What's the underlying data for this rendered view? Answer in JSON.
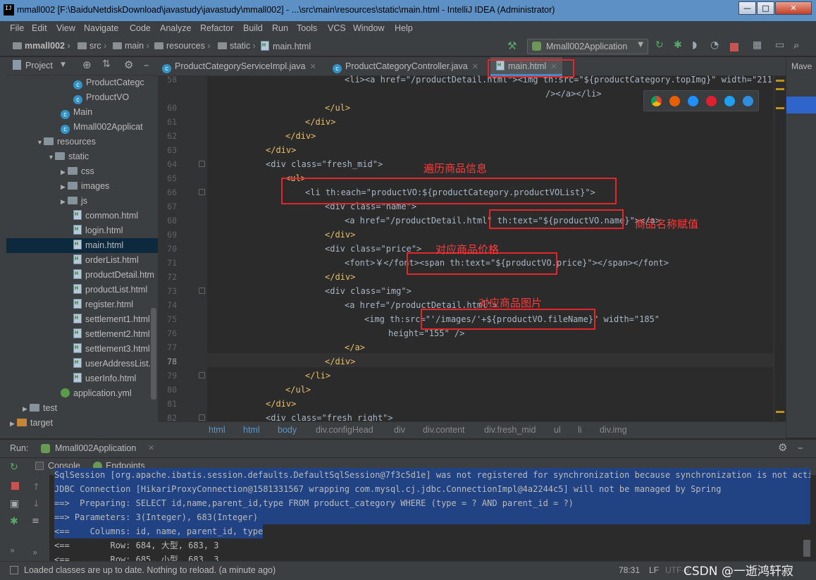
{
  "window": {
    "title": "mmall002 [F:\\BaiduNetdiskDownload\\javastudy\\javastudy\\mmall002] - ...\\src\\main\\resources\\static\\main.html - IntelliJ IDEA (Administrator)",
    "icon_text": "IJ",
    "min": "—",
    "max": "□",
    "close": "✕"
  },
  "menu": [
    "File",
    "Edit",
    "View",
    "Navigate",
    "Code",
    "Analyze",
    "Refactor",
    "Build",
    "Run",
    "Tools",
    "VCS",
    "Window",
    "Help"
  ],
  "nav": {
    "crumbs": [
      "mmall002",
      "src",
      "main",
      "resources",
      "static",
      "main.html"
    ],
    "run_config": "Mmall002Application"
  },
  "project": {
    "label": "Project",
    "tree": [
      {
        "label": "ProductCategc",
        "icon": "class"
      },
      {
        "label": "ProductVO",
        "icon": "class"
      },
      {
        "label": "Main",
        "icon": "class"
      },
      {
        "label": "Mmall002Applicat",
        "icon": "class"
      },
      {
        "label": "resources",
        "icon": "folder"
      },
      {
        "label": "static",
        "icon": "folder"
      },
      {
        "label": "css",
        "icon": "folder"
      },
      {
        "label": "images",
        "icon": "folder"
      },
      {
        "label": "js",
        "icon": "folder"
      },
      {
        "label": "common.html",
        "icon": "html"
      },
      {
        "label": "login.html",
        "icon": "html"
      },
      {
        "label": "main.html",
        "icon": "html"
      },
      {
        "label": "orderList.html",
        "icon": "html"
      },
      {
        "label": "productDetail.htm",
        "icon": "html"
      },
      {
        "label": "productList.html",
        "icon": "html"
      },
      {
        "label": "register.html",
        "icon": "html"
      },
      {
        "label": "settlement1.html",
        "icon": "html"
      },
      {
        "label": "settlement2.html",
        "icon": "html"
      },
      {
        "label": "settlement3.html",
        "icon": "html"
      },
      {
        "label": "userAddressList.h",
        "icon": "html"
      },
      {
        "label": "userInfo.html",
        "icon": "html"
      },
      {
        "label": "application.yml",
        "icon": "yml"
      },
      {
        "label": "test",
        "icon": "folder"
      },
      {
        "label": "target",
        "icon": "folder"
      }
    ]
  },
  "tabs": [
    {
      "label": "ProductCategoryServiceImpl.java"
    },
    {
      "label": "ProductCategoryController.java"
    },
    {
      "label": "main.html"
    }
  ],
  "right_tool": "Mave",
  "editor": {
    "line_numbers": [
      "58",
      "59",
      "60",
      "61",
      "62",
      "63",
      "64",
      "65",
      "66",
      "67",
      "68",
      "69",
      "70",
      "71",
      "72",
      "73",
      "74",
      "75",
      "76",
      "77",
      "78",
      "79",
      "80",
      "81",
      "82"
    ],
    "lines": [
      "<li><a href=\"/productDetail.html\"><img th:src=\"${productCategory.topImg}\" width=\"211\"",
      "/></a></li>",
      "</ul>",
      "</div>",
      "</div>",
      "</div>",
      "<div class=\"fresh_mid\">",
      "<ul>",
      "<li th:each=\"productVO:${productCategory.productVOList}\">",
      "<div class=\"name\">",
      "<a href=\"/productDetail.html\" th:text=\"${productVO.name}\"></a>",
      "</div>",
      "<div class=\"price\">",
      "<font>￥</font><span th:text=\"${productVO.price}\"></span></font>",
      "</div>",
      "<div class=\"img\">",
      "<a href=\"/productDetail.html\">",
      "<img th:src=\"'/images/'+${productVO.fileName}\" width=\"185\"",
      "height=\"155\" />",
      "</a>",
      "</div>",
      "</li>",
      "</ul>",
      "</div>",
      "<div class=\"fresh_right\">"
    ]
  },
  "annotations": {
    "loop_goods": "遍历商品信息",
    "assign_name": "商品名称赋值",
    "price": "对应商品价格",
    "image": "对应商品图片"
  },
  "breadcrumb": [
    "html",
    "html",
    "body",
    "div.configHead",
    "div",
    "div.content",
    "div.fresh_mid",
    "ul",
    "li",
    "div.img"
  ],
  "run": {
    "label": "Run:",
    "config": "Mmall002Application",
    "tabs": [
      "Console",
      "Endpoints"
    ],
    "lines": [
      "SqlSession [org.apache.ibatis.session.defaults.DefaultSqlSession@7f3c5d1e] was not registered for synchronization because synchronization is not active",
      "JDBC Connection [HikariProxyConnection@1581331567 wrapping com.mysql.cj.jdbc.ConnectionImpl@4a2244c5] will not be managed by Spring",
      "==>  Preparing: SELECT id,name,parent_id,type FROM product_category WHERE (type = ? AND parent_id = ?)",
      "==> Parameters: 3(Integer), 683(Integer)",
      "<==    Columns: id, name, parent_id, type",
      "<==        Row: 684, 大型, 683, 3",
      "<==        Row: 685, 小型, 683, 3"
    ]
  },
  "status": {
    "message": "Loaded classes are up to date. Nothing to reload. (a minute ago)",
    "position": "78:31",
    "line_sep": "LF",
    "encoding": "UTF-8",
    "watermark": "CSDN @一逝鸿轩寂"
  }
}
